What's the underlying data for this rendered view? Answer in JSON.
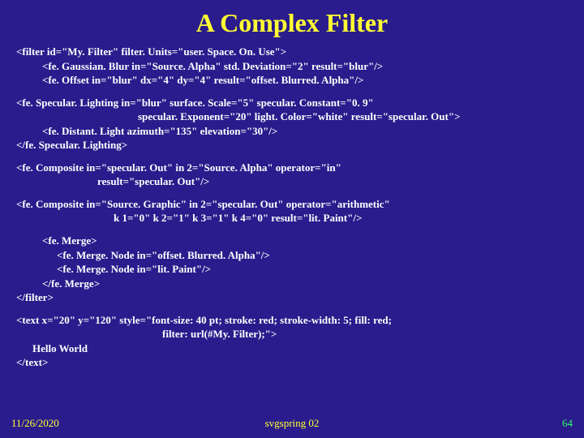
{
  "title": "A Complex Filter",
  "code": {
    "l1": "<filter id=\"My. Filter\" filter. Units=\"user. Space. On. Use\">",
    "l2": "<fe. Gaussian. Blur in=\"Source. Alpha\" std. Deviation=\"2\" result=\"blur\"/>",
    "l3": "<fe. Offset in=\"blur\" dx=\"4\" dy=\"4\" result=\"offset. Blurred. Alpha\"/>",
    "l4": "<fe. Specular. Lighting in=\"blur\" surface. Scale=\"5\" specular. Constant=\"0. 9\"",
    "l5": "specular. Exponent=\"20\" light. Color=\"white\" result=\"specular. Out\">",
    "l6": "<fe. Distant. Light azimuth=\"135\" elevation=\"30\"/>",
    "l7": "</fe. Specular. Lighting>",
    "l8": "<fe. Composite in=\"specular. Out\" in 2=\"Source. Alpha\" operator=\"in\"",
    "l9": "result=\"specular. Out\"/>",
    "l10": "<fe. Composite in=\"Source. Graphic\" in 2=\"specular. Out\" operator=\"arithmetic\"",
    "l11": "k 1=\"0\" k 2=\"1\" k 3=\"1\" k 4=\"0\" result=\"lit. Paint\"/>",
    "l12": "<fe. Merge>",
    "l13": "<fe. Merge. Node in=\"offset. Blurred. Alpha\"/>",
    "l14": "<fe. Merge. Node in=\"lit. Paint\"/>",
    "l15": "</fe. Merge>",
    "l16": "</filter>",
    "l17": "<text x=\"20\" y=\"120\" style=\"font-size: 40 pt; stroke: red; stroke-width: 5; fill: red;",
    "l18": "filter: url(#My. Filter);\">",
    "l19": "Hello World",
    "l20": "</text>"
  },
  "footer": {
    "date": "11/26/2020",
    "center": "svgspring 02",
    "page": "64"
  }
}
